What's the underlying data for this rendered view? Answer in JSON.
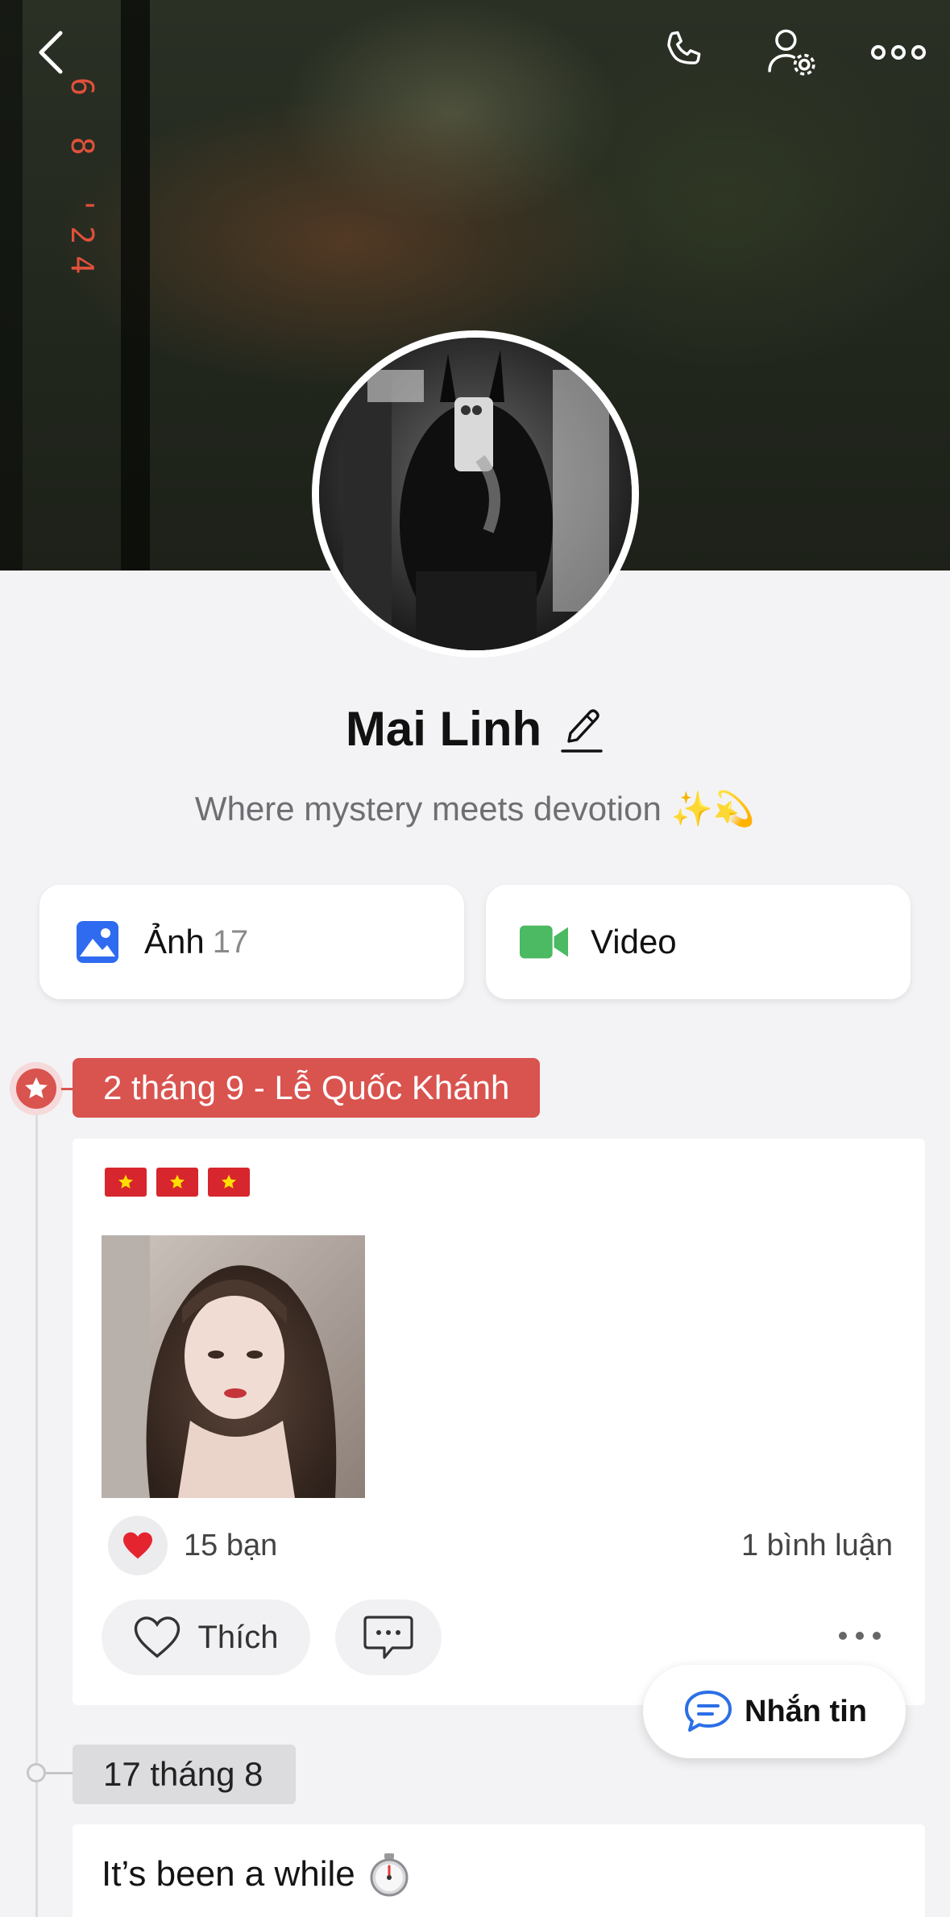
{
  "cover": {
    "date_stamp": "6 8 '24"
  },
  "profile": {
    "name": "Mai Linh",
    "bio": "Where mystery meets devotion ✨💫"
  },
  "media": {
    "photos_label": "Ảnh",
    "photos_count": "17",
    "video_label": "Video"
  },
  "timeline": {
    "event_tag": "2 tháng 9 - Lễ Quốc Khánh",
    "post1": {
      "flags": [
        "🇻🇳",
        "🇻🇳",
        "🇻🇳"
      ],
      "reaction_count": "15 bạn",
      "comment_count": "1 bình luận",
      "like_label": "Thích"
    },
    "date_tag": "17 tháng 8",
    "post2": {
      "text": "It’s been a while"
    }
  },
  "fab": {
    "label": "Nhắn tin"
  },
  "icons": {
    "back": "chevron-left-icon",
    "call": "phone-icon",
    "settings": "user-settings-icon",
    "more": "more-horizontal-icon",
    "edit": "pencil-icon",
    "photos": "image-icon",
    "video": "video-camera-icon",
    "heart": "heart-icon",
    "comment": "comment-icon",
    "message": "chat-bubble-icon",
    "timer": "stopwatch-icon"
  },
  "colors": {
    "accent_red": "#d9534f",
    "photo_blue": "#2f6bf0",
    "video_green": "#4cb963",
    "message_blue": "#2c6fe6"
  }
}
